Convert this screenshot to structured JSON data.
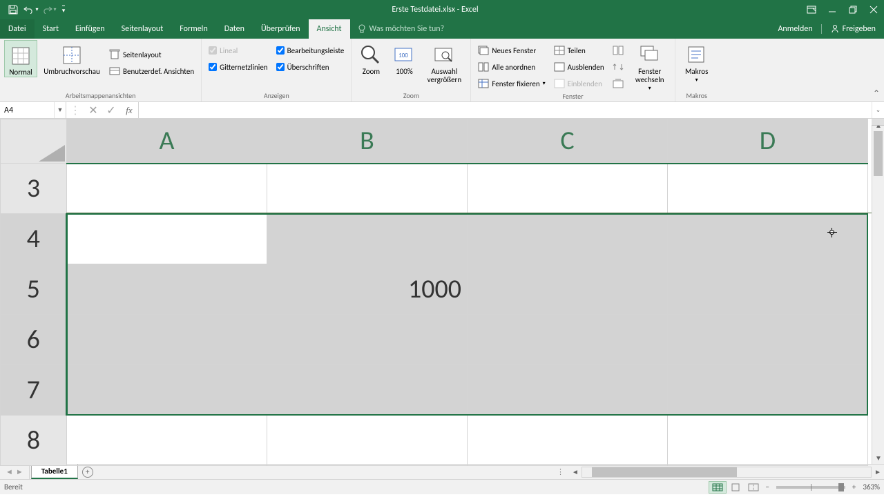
{
  "title": "Erste Testdatei.xlsx - Excel",
  "qat": {
    "save": "save",
    "undo": "undo",
    "redo": "redo"
  },
  "tabs": {
    "file": "Datei",
    "list": [
      "Start",
      "Einfügen",
      "Seitenlayout",
      "Formeln",
      "Daten",
      "Überprüfen",
      "Ansicht"
    ],
    "active": "Ansicht",
    "tell_me_placeholder": "Was möchten Sie tun?",
    "sign_in": "Anmelden",
    "share": "Freigeben"
  },
  "ribbon": {
    "groups": {
      "views": {
        "label": "Arbeitsmappenansichten",
        "normal": "Normal",
        "page_break": "Umbruchvorschau",
        "page_layout": "Seitenlayout",
        "custom_views": "Benutzerdef. Ansichten"
      },
      "show": {
        "label": "Anzeigen",
        "ruler": "Lineal",
        "formula_bar": "Bearbeitungsleiste",
        "gridlines": "Gitternetzlinien",
        "headings": "Überschriften",
        "ruler_checked": true,
        "formula_bar_checked": true,
        "gridlines_checked": true,
        "headings_checked": true
      },
      "zoom": {
        "label": "Zoom",
        "zoom": "Zoom",
        "hundred": "100%",
        "selection": "Auswahl vergrößern"
      },
      "window": {
        "label": "Fenster",
        "new_window": "Neues Fenster",
        "arrange_all": "Alle anordnen",
        "freeze": "Fenster fixieren",
        "split": "Teilen",
        "hide": "Ausblenden",
        "unhide": "Einblenden",
        "switch": "Fenster wechseln"
      },
      "macros": {
        "label": "Makros",
        "macros": "Makros"
      }
    }
  },
  "namebox": "A4",
  "formula": "",
  "columns": [
    "A",
    "B",
    "C",
    "D"
  ],
  "rows": [
    "3",
    "4",
    "5",
    "6",
    "7",
    "8"
  ],
  "selected_rows": [
    "4",
    "5",
    "6",
    "7"
  ],
  "active_cell": "A4",
  "cells": {
    "B5": "1000"
  },
  "sheet_tab": "Tabelle1",
  "status": {
    "ready": "Bereit",
    "zoom": "363%"
  }
}
